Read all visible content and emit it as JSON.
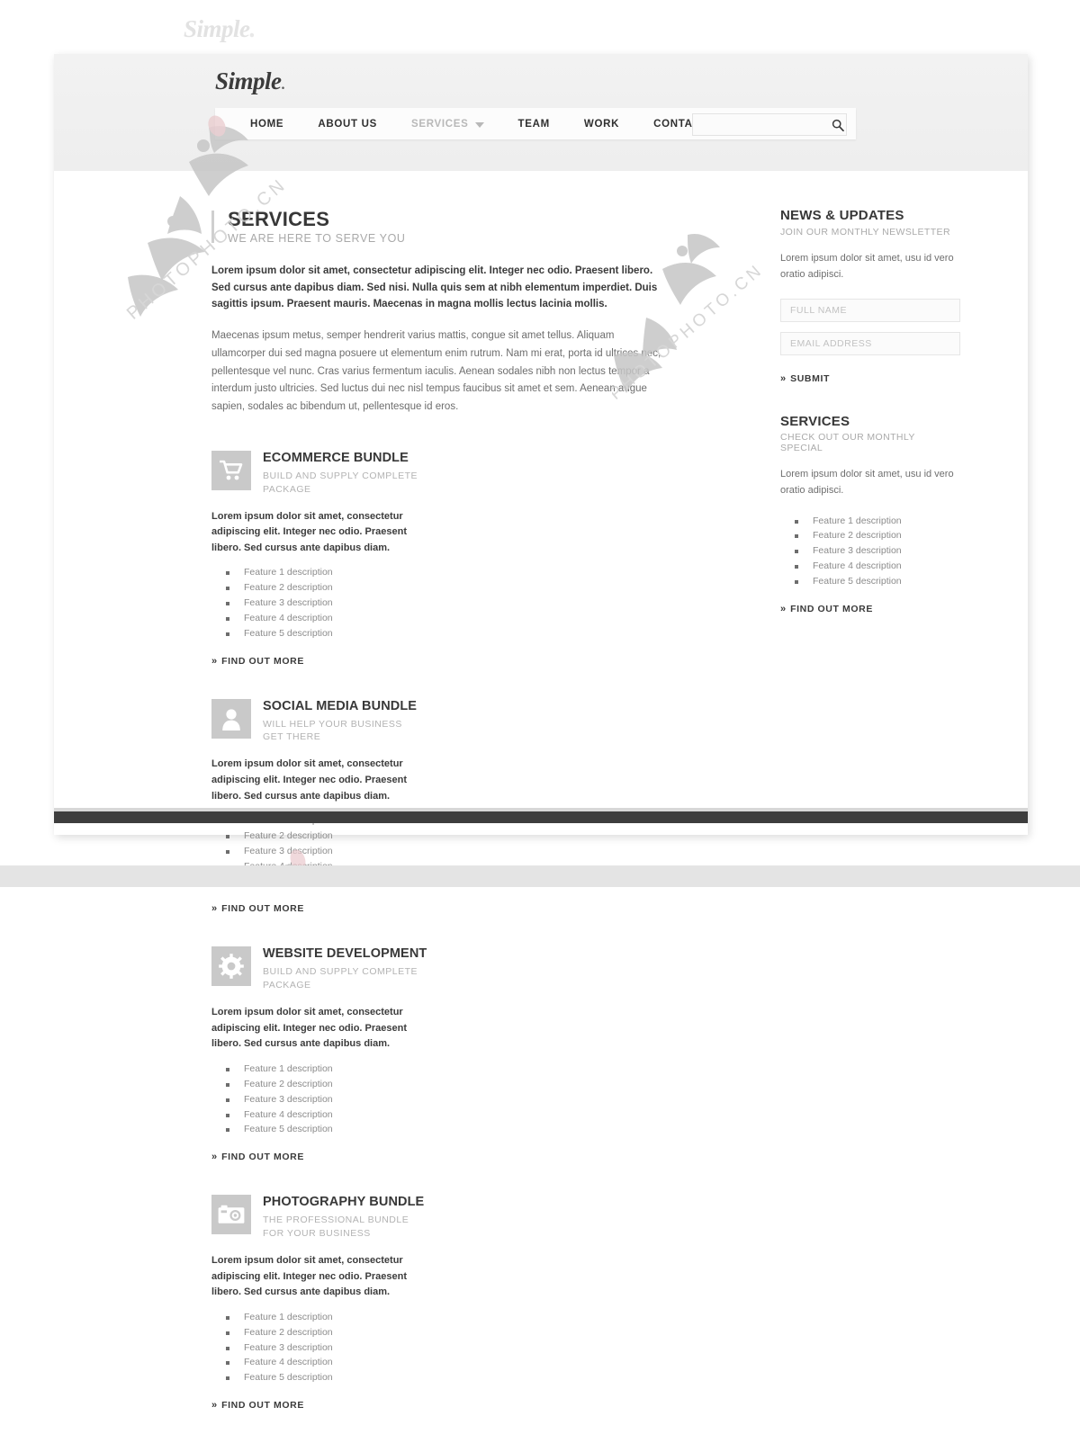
{
  "watermark": {
    "top_brand": "Simple",
    "top_brand_dot": ".",
    "overlay_text": "PHOTOPHOTO.CN"
  },
  "header": {
    "brand": "Simple",
    "brand_dot": ".",
    "nav": [
      {
        "label": "HOME",
        "muted": false,
        "has_caret": false
      },
      {
        "label": "ABOUT US",
        "muted": false,
        "has_caret": false
      },
      {
        "label": "SERVICES",
        "muted": true,
        "has_caret": true
      },
      {
        "label": "TEAM",
        "muted": false,
        "has_caret": false
      },
      {
        "label": "WORK",
        "muted": false,
        "has_caret": false
      },
      {
        "label": "CONTACT",
        "muted": false,
        "has_caret": false
      }
    ],
    "search": {
      "value": "",
      "placeholder": "",
      "icon": "search-icon"
    }
  },
  "main": {
    "title": "SERVICES",
    "subtitle": "WE ARE HERE TO SERVE YOU",
    "lead_paragraph": "Lorem ipsum dolor sit amet, consectetur adipiscing elit. Integer nec odio. Praesent libero. Sed cursus ante dapibus diam. Sed nisi. Nulla quis sem at nibh elementum imperdiet. Duis sagittis ipsum. Praesent mauris. Maecenas in magna mollis lectus lacinia mollis.",
    "body_paragraph": "Maecenas ipsum metus, semper hendrerit varius mattis, congue sit amet tellus. Aliquam ullamcorper dui sed magna posuere ut elementum enim rutrum. Nam mi erat, porta id ultrices nec, pellentesque vel nunc. Cras varius fermentum iaculis. Aenean sodales nibh non lectus tempor a interdum justo ultricies. Sed luctus dui nec nisl tempus faucibus sit amet et sem. Aenean augue sapien, sodales ac bibendum ut, pellentesque id eros.",
    "card_description": "Lorem ipsum dolor sit amet, consectetur adipiscing elit. Integer nec odio. Praesent libero. Sed cursus ante dapibus diam.",
    "find_out_more": "FIND OUT MORE",
    "chevron": "»",
    "features": [
      "Feature 1 description",
      "Feature 2 description",
      "Feature 3 description",
      "Feature 4 description",
      "Feature 5 description"
    ],
    "cards": [
      {
        "title": "ECOMMERCE BUNDLE",
        "subtitle": "BUILD AND SUPPLY COMPLETE PACKAGE",
        "icon": "shopping-cart-icon"
      },
      {
        "title": "SOCIAL MEDIA BUNDLE",
        "subtitle": "WILL HELP YOUR BUSINESS GET THERE",
        "icon": "person-icon"
      },
      {
        "title": "WEBSITE DEVELOPMENT",
        "subtitle": "BUILD AND SUPPLY COMPLETE PACKAGE",
        "icon": "gear-icon"
      },
      {
        "title": "PHOTOGRAPHY BUNDLE",
        "subtitle": "THE PROFESSIONAL BUNDLE FOR YOUR BUSINESS",
        "icon": "camera-icon"
      }
    ]
  },
  "sidebar": {
    "news": {
      "title": "NEWS & UPDATES",
      "subtitle": "JOIN OUR MONTHLY NEWSLETTER",
      "text": "Lorem ipsum dolor sit amet, usu id vero oratio adipisci.",
      "full_name_value": "",
      "full_name_placeholder": "FULL NAME",
      "email_value": "",
      "email_placeholder": "EMAIL ADDRESS",
      "submit_label": "SUBMIT",
      "chevron": "»"
    },
    "services": {
      "title": "SERVICES",
      "subtitle": "CHECK OUT OUR MONTHLY SPECIAL",
      "text": "Lorem ipsum dolor sit amet, usu id vero oratio adipisci.",
      "features": [
        "Feature 1 description",
        "Feature 2 description",
        "Feature 3 description",
        "Feature 4 description",
        "Feature 5 description"
      ],
      "find_out_more": "FIND OUT MORE",
      "chevron": "»"
    }
  },
  "colors": {
    "page_bg": "#ffffff",
    "header_bg": "#f0f0f0",
    "icon_box": "#c9c9c9",
    "footer_bar": "#3d3d3d",
    "accent_bar": "#cfcfcf",
    "muted_text": "#b3b3b3",
    "body_text": "#6d6d6d",
    "heading_text": "#373737"
  }
}
